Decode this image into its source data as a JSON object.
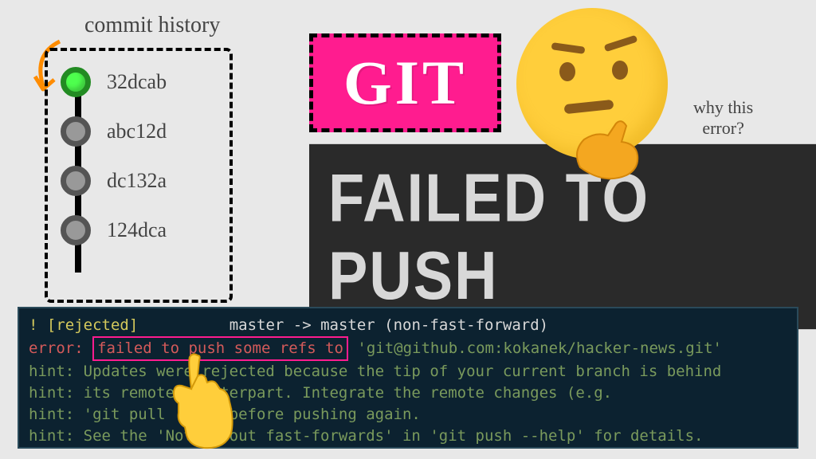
{
  "labels": {
    "commit_history": "commit history",
    "why_error_line1": "why this",
    "why_error_line2": "error?"
  },
  "titles": {
    "git": "GIT",
    "failed": "FAILED TO PUSH"
  },
  "commits": [
    {
      "hash": "32dcab",
      "head": true
    },
    {
      "hash": "abc12d",
      "head": false
    },
    {
      "hash": "dc132a",
      "head": false
    },
    {
      "hash": "124dca",
      "head": false
    }
  ],
  "terminal": {
    "line1_bang": " !",
    "line1_rejected": "[rejected]",
    "line1_rest": "master -> master (non-fast-forward)",
    "line2_error": "error:",
    "line2_boxed": "failed to push some refs to",
    "line2_repo": "'git@github.com:kokanek/hacker-news.git'",
    "line3": "hint: Updates were rejected because the tip of your current branch is behind",
    "line4": "hint: its remote counterpart. Integrate the remote changes (e.g.",
    "line5": "hint: 'git pull ...') before pushing again.",
    "line6": "hint: See the 'Note about fast-forwards' in 'git push --help' for details."
  },
  "icons": {
    "thinking_emoji": "thinking-face",
    "pointer": "pointing-up-hand",
    "arrow": "curved-arrow"
  }
}
